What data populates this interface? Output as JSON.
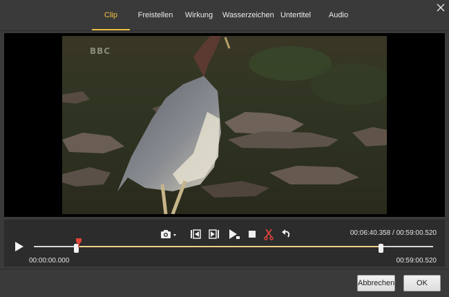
{
  "tabs": [
    {
      "label": "Clip",
      "active": true
    },
    {
      "label": "Freistellen",
      "active": false
    },
    {
      "label": "Wirkung",
      "active": false
    },
    {
      "label": "Wasserzeichen",
      "active": false
    },
    {
      "label": "Untertitel",
      "active": false
    },
    {
      "label": "Audio",
      "active": false
    }
  ],
  "video": {
    "watermark": "BBC"
  },
  "player": {
    "current_time": "00:06:40.358",
    "separator": "/",
    "total_time": "00:59:00.520",
    "clip_start": "00:00:00.000",
    "clip_end": "00:59:00.520",
    "playhead_progress": 0.113,
    "selection_start_progress": 0.107,
    "selection_end_progress": 0.87
  },
  "toolbar_icons": [
    "camera-icon",
    "previous-frame-icon",
    "next-frame-icon",
    "play-segment-icon",
    "stop-icon",
    "cut-icon",
    "undo-icon"
  ],
  "colors": {
    "accent": "#f1c341",
    "playhead": "#e0453a",
    "background": "#3a3a3a",
    "panel": "#2c2c2c"
  },
  "footer": {
    "cancel_label": "Abbrechen",
    "ok_label": "OK"
  }
}
